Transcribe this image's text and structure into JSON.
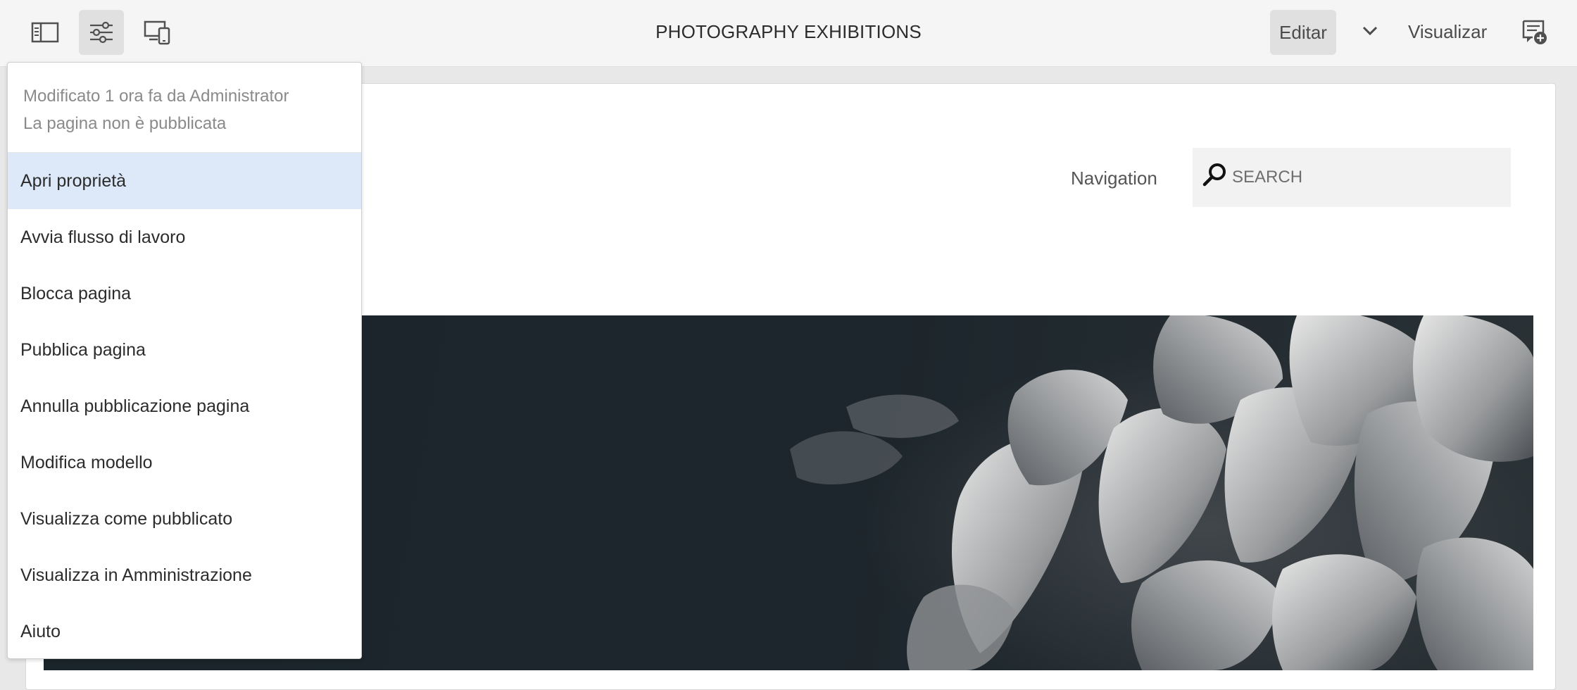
{
  "toolbar": {
    "title": "PHOTOGRAPHY EXHIBITIONS",
    "mode_label": "Editar",
    "preview_label": "Visualizar",
    "icons": [
      "side-panel-icon",
      "page-properties-icon",
      "emulator-icon",
      "chevron-down-icon",
      "annotate-icon"
    ]
  },
  "page_menu": {
    "modified_text": "Modificato 1 ora fa da Administrator",
    "publish_status": "La pagina non è pubblicata",
    "items": [
      {
        "label": "Apri proprietà",
        "selected": true
      },
      {
        "label": "Avvia flusso di lavoro"
      },
      {
        "label": "Blocca pagina"
      },
      {
        "label": "Pubblica pagina"
      },
      {
        "label": "Annulla pubblicazione pagina"
      },
      {
        "label": "Modifica modello"
      },
      {
        "label": "Visualizza come pubblicato"
      },
      {
        "label": "Visualizza in Amministrazione"
      },
      {
        "label": "Aiuto"
      }
    ]
  },
  "site": {
    "nav_label": "Navigation",
    "search_placeholder": "SEARCH",
    "hero_image": "black-and-white flower photo"
  },
  "colors": {
    "toolbar_bg": "#f5f5f5",
    "selected_item": "#dde8f8",
    "hero_dark": "#1d262c"
  }
}
